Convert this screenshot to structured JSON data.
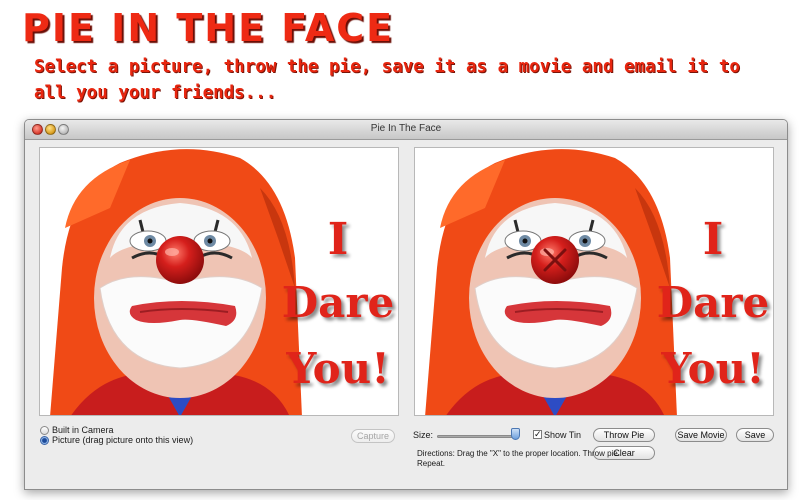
{
  "promo": {
    "title": "PIE IN THE FACE",
    "subtitle": "Select a picture, throw the pie, save it as a movie and email it to all you your friends..."
  },
  "window": {
    "title": "Pie In The Face",
    "controls": [
      "close",
      "minimize",
      "zoom"
    ]
  },
  "image_text": {
    "line1": "I",
    "line2": "Dare",
    "line3": "You!"
  },
  "source": {
    "options": [
      {
        "label": "Built in Camera",
        "selected": false
      },
      {
        "label": "Picture (drag picture onto this view)",
        "selected": true
      }
    ],
    "capture_label": "Capture",
    "capture_enabled": false
  },
  "controls": {
    "size_label": "Size:",
    "size_value": 0.95,
    "show_tin_label": "Show Tin",
    "show_tin_checked": true,
    "throw_pie_label": "Throw Pie",
    "clear_label": "Clear",
    "save_movie_label": "Save Movie",
    "save_label": "Save",
    "directions": "Directions: Drag the \"X\" to the proper location.  Throw pie.  Repeat."
  },
  "colors": {
    "accent_red": "#e0241a",
    "wig_orange": "#f04a16",
    "nose_red": "#d51f1c"
  },
  "icons": [
    "close-icon",
    "minimize-icon",
    "zoom-icon",
    "target-x-icon",
    "checkmark-icon"
  ]
}
